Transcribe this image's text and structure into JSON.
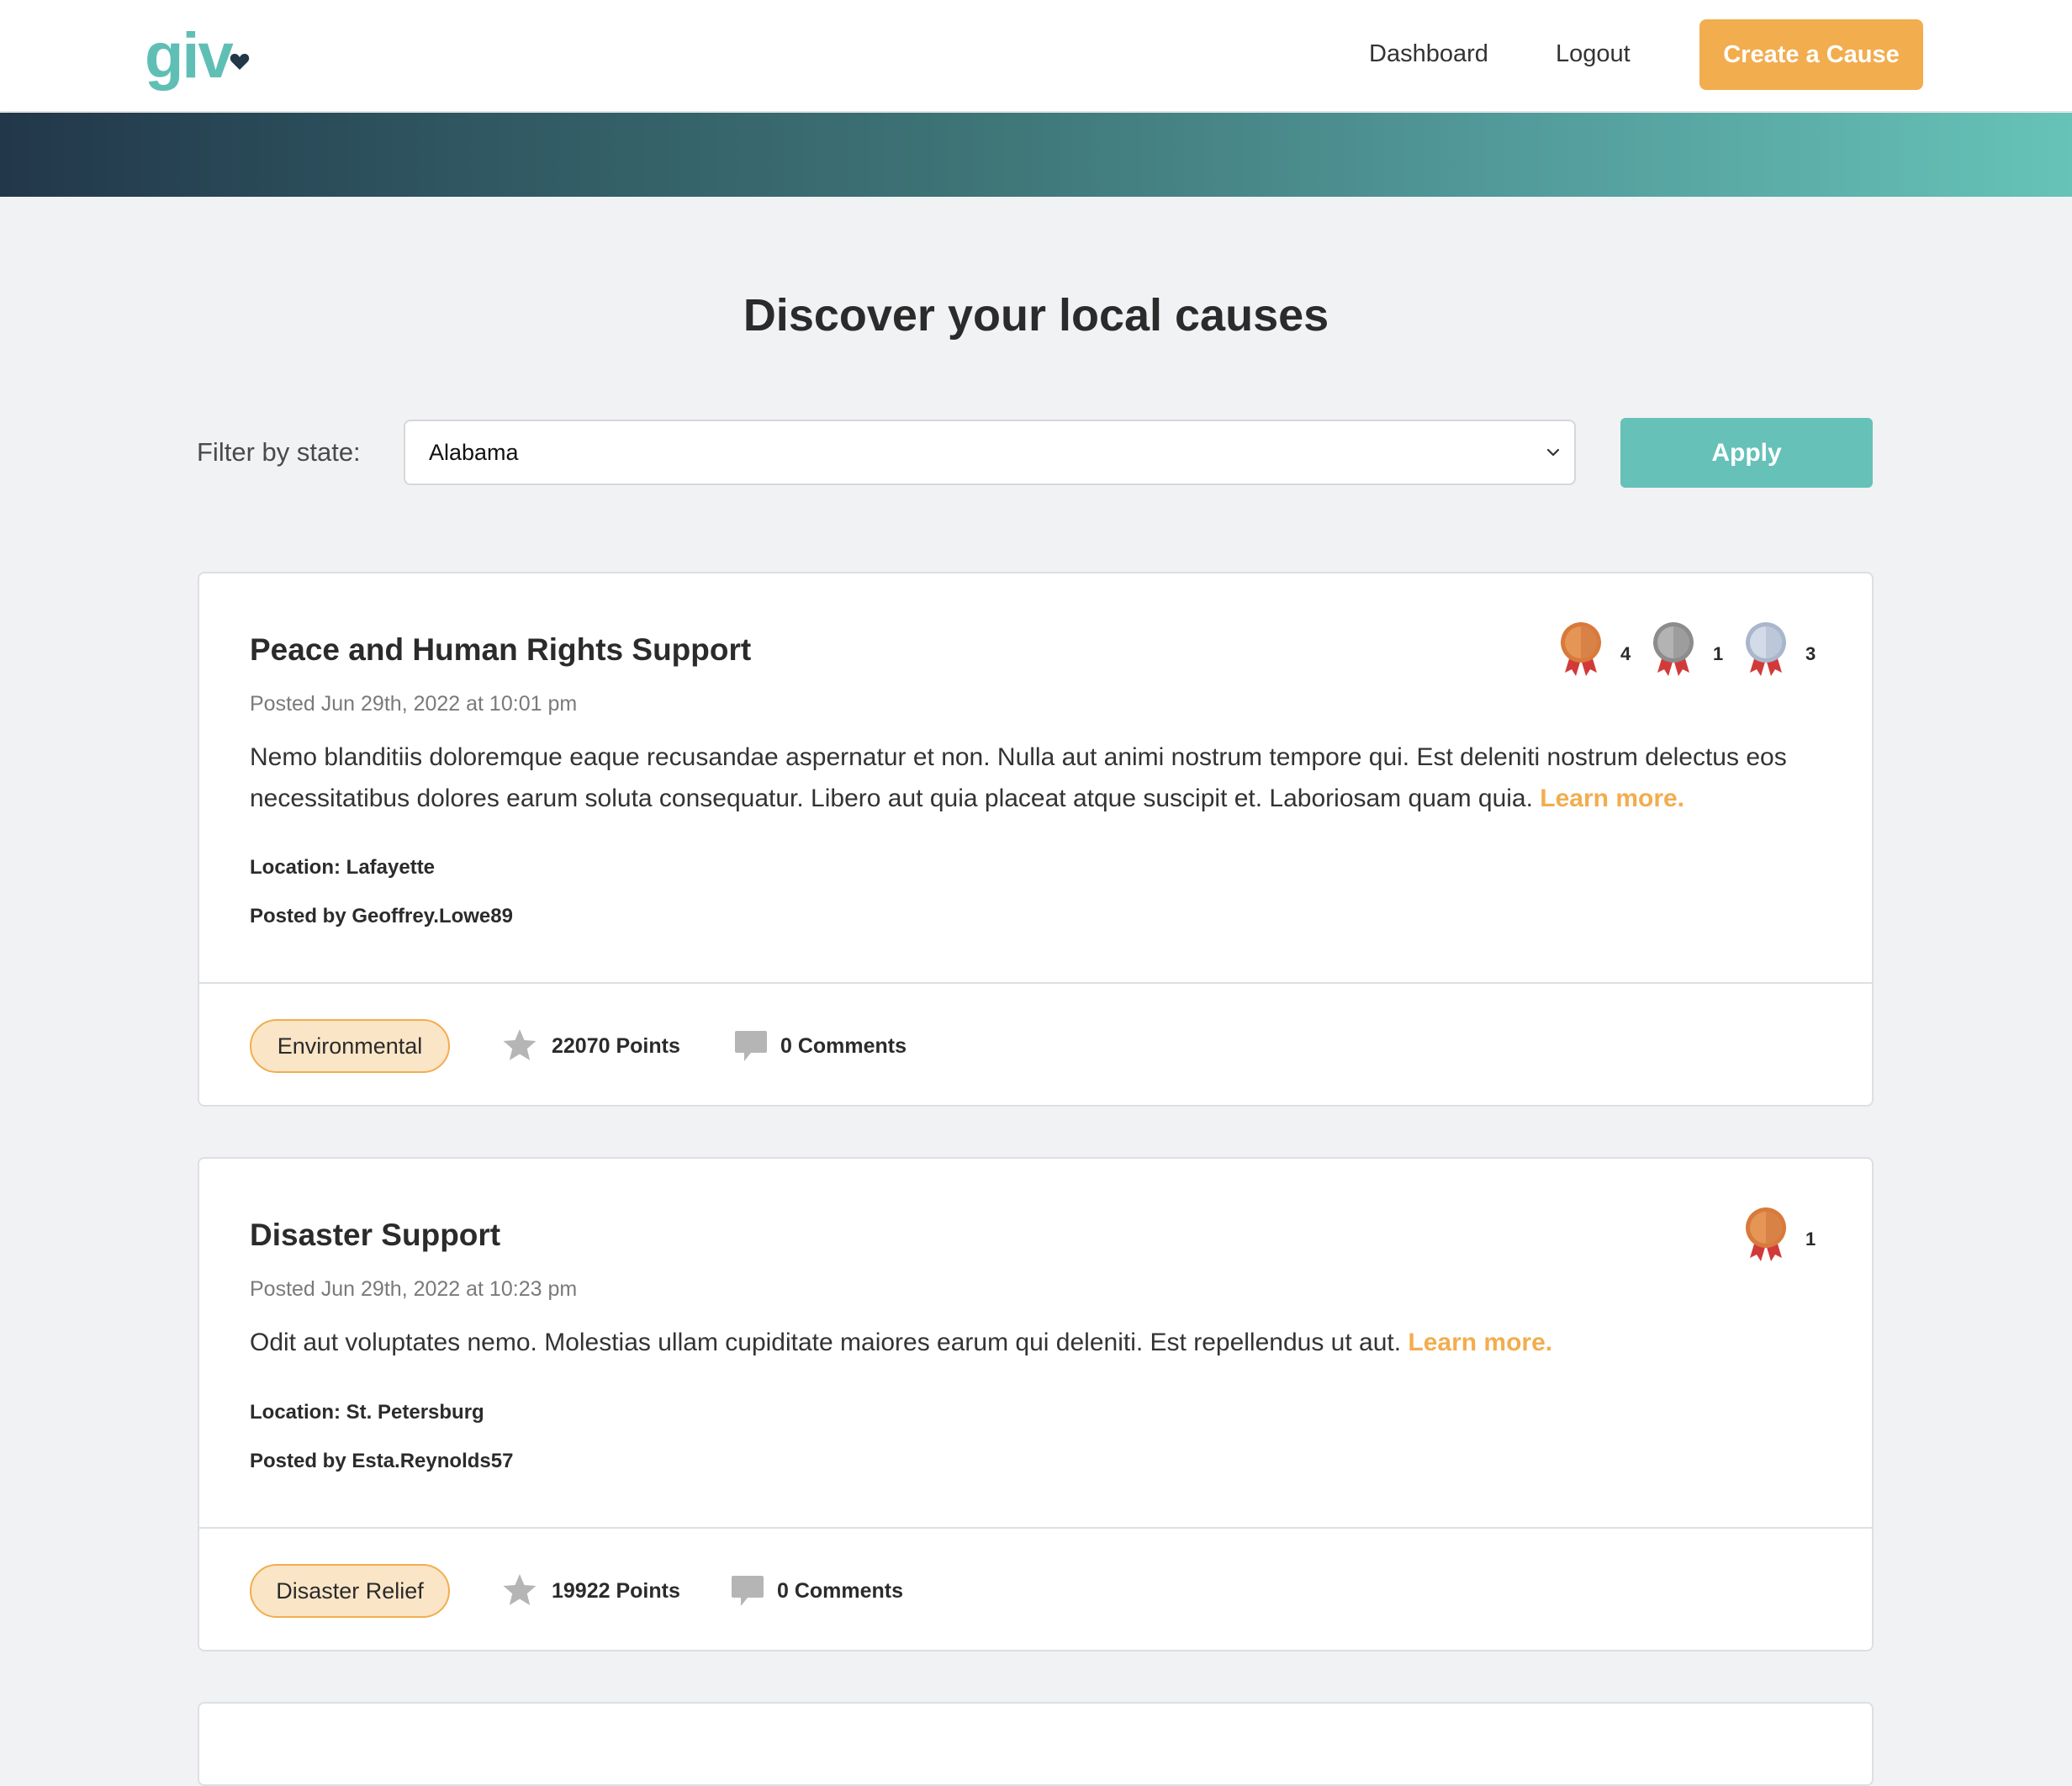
{
  "header": {
    "logo": "giv",
    "nav": [
      "Dashboard",
      "Logout"
    ],
    "create_button": "Create a Cause"
  },
  "page": {
    "title": "Discover your local causes"
  },
  "filter": {
    "label": "Filter by state:",
    "selected_state": "Alabama",
    "apply_button": "Apply"
  },
  "colors": {
    "accent_orange": "#f2ad4e",
    "accent_teal": "#66c1b8",
    "tag_fill": "#fae5c7"
  },
  "causes": [
    {
      "title": "Peace and Human Rights Support",
      "posted": "Posted Jun 29th, 2022 at 10:01 pm",
      "description": "Nemo blanditiis doloremque eaque recusandae aspernatur et non. Nulla aut animi nostrum tempore qui. Est deleniti nostrum delectus eos necessitatibus dolores earum soluta consequatur. Libero aut quia placeat atque suscipit et. Laboriosam quam quia.",
      "learn_more": "Learn more.",
      "location": "Location: Lafayette",
      "posted_by": "Posted by Geoffrey.Lowe89",
      "tag": "Environmental",
      "points": "22070 Points",
      "comments": "0 Comments",
      "awards": [
        {
          "type": "bronze-award-icon",
          "count": "4"
        },
        {
          "type": "silver-award-icon",
          "count": "1"
        },
        {
          "type": "platinum-award-icon",
          "count": "3"
        }
      ]
    },
    {
      "title": "Disaster Support",
      "posted": "Posted Jun 29th, 2022 at 10:23 pm",
      "description": "Odit aut voluptates nemo. Molestias ullam cupiditate maiores earum qui deleniti. Est repellendus ut aut.",
      "learn_more": "Learn more.",
      "location": "Location: St. Petersburg",
      "posted_by": "Posted by Esta.Reynolds57",
      "tag": "Disaster Relief",
      "points": "19922 Points",
      "comments": "0 Comments",
      "awards": [
        {
          "type": "bronze-award-icon",
          "count": "1"
        }
      ]
    }
  ]
}
